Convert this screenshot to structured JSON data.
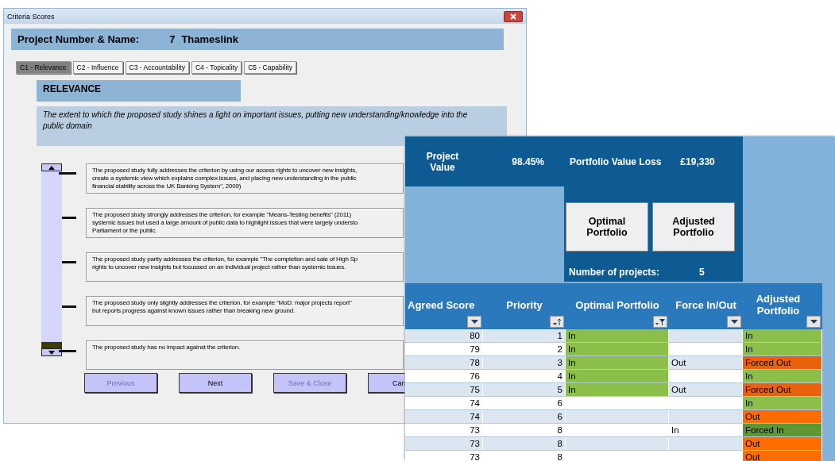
{
  "dialog": {
    "title": "Criteria Scores",
    "project_label": "Project Number & Name:",
    "project_number": "7",
    "project_name": "Thameslink",
    "tabs": [
      {
        "label": "C1 - Relevance",
        "selected": true
      },
      {
        "label": "C2 - Influence",
        "selected": false
      },
      {
        "label": "C3 - Accountability",
        "selected": false
      },
      {
        "label": "C4 - Topicality",
        "selected": false
      },
      {
        "label": "C5 - Capability",
        "selected": false
      }
    ],
    "section_title": "RELEVANCE",
    "description": "The extent to which the proposed study shines a light on important issues, putting new understanding/knowledge into the public domain",
    "slider": {
      "level": 0
    },
    "options": [
      {
        "lines": [
          "The proposed study fully addresses the criterion by using our access rights to uncover new insights,",
          "create a systemic view which explains complex issues, and placing new understanding in the public",
          "financial stability across the UK Banking System\", 2009)"
        ]
      },
      {
        "lines": [
          "The proposed study strongly addresses the criterion, for example \"Means-Testing benefits\" (2011)",
          "systemic issues but used a large amount of public data to highlight issues that were largely understo",
          "Parliament or the public."
        ]
      },
      {
        "lines": [
          "The proposed study partly addresses the criterion, for example \"The completion and sale of High Sp",
          "rights to uncover new insights but focussed on an individual project rather than systemic issues."
        ]
      },
      {
        "lines": [
          "The proposed study only slightly addresses the criterion, for example \"MoD: major projects report\"",
          "but reports progress against known issues rather than breaking new ground."
        ]
      },
      {
        "lines": [
          "The proposed study has no impact against the criterion."
        ]
      }
    ],
    "buttons": [
      {
        "label": "Previous",
        "disabled": true
      },
      {
        "label": "Next",
        "disabled": false
      },
      {
        "label": "Save & Close",
        "disabled": true
      },
      {
        "label": "Can",
        "disabled": false
      }
    ]
  },
  "portfolio": {
    "project_value_label": "Project Value",
    "project_value": "98.45%",
    "loss_label": "Portfolio Value Loss",
    "loss": "£19,330",
    "buttons": [
      "Optimal Portfolio",
      "Adjusted Portfolio"
    ],
    "count_label": "Number of projects:",
    "count": "5",
    "table": {
      "columns": [
        {
          "label": "Agreed Score",
          "kind": "dropdown"
        },
        {
          "label": "Priority",
          "kind": "sort"
        },
        {
          "label": "Optimal Portfolio",
          "kind": "filtered"
        },
        {
          "label": "Force In/Out",
          "kind": "dropdown"
        },
        {
          "label": "Adjusted Portfolio",
          "kind": "dropdown"
        }
      ],
      "rows": [
        {
          "score": "80",
          "priority": "1",
          "optimal": "In",
          "adjusted": "In",
          "color": "#8cbf4a"
        },
        {
          "score": "79",
          "priority": "2",
          "optimal": "In",
          "adjusted": "In",
          "color": "#8cbf4a"
        },
        {
          "score": "78",
          "priority": "3",
          "optimal": "In",
          "force": "Out",
          "adjusted": "Forced Out",
          "color": "#e8620c"
        },
        {
          "score": "76",
          "priority": "4",
          "optimal": "In",
          "adjusted": "In",
          "color": "#8cbf4a"
        },
        {
          "score": "75",
          "priority": "5",
          "optimal": "In",
          "force": "Out",
          "adjusted": "Forced Out",
          "color": "#e8620c"
        },
        {
          "score": "74",
          "priority": "6",
          "adjusted": "In",
          "color": "#8cbf4a"
        },
        {
          "score": "74",
          "priority": "6",
          "adjusted": "Out",
          "color": "#ff6d00"
        },
        {
          "score": "73",
          "priority": "8",
          "force": "In",
          "adjusted": "Forced In",
          "color": "#5f9632"
        },
        {
          "score": "73",
          "priority": "8",
          "adjusted": "Out",
          "color": "#ff6d00"
        },
        {
          "score": "73",
          "priority": "8",
          "adjusted": "Out",
          "color": "#ff6d00"
        }
      ]
    }
  }
}
